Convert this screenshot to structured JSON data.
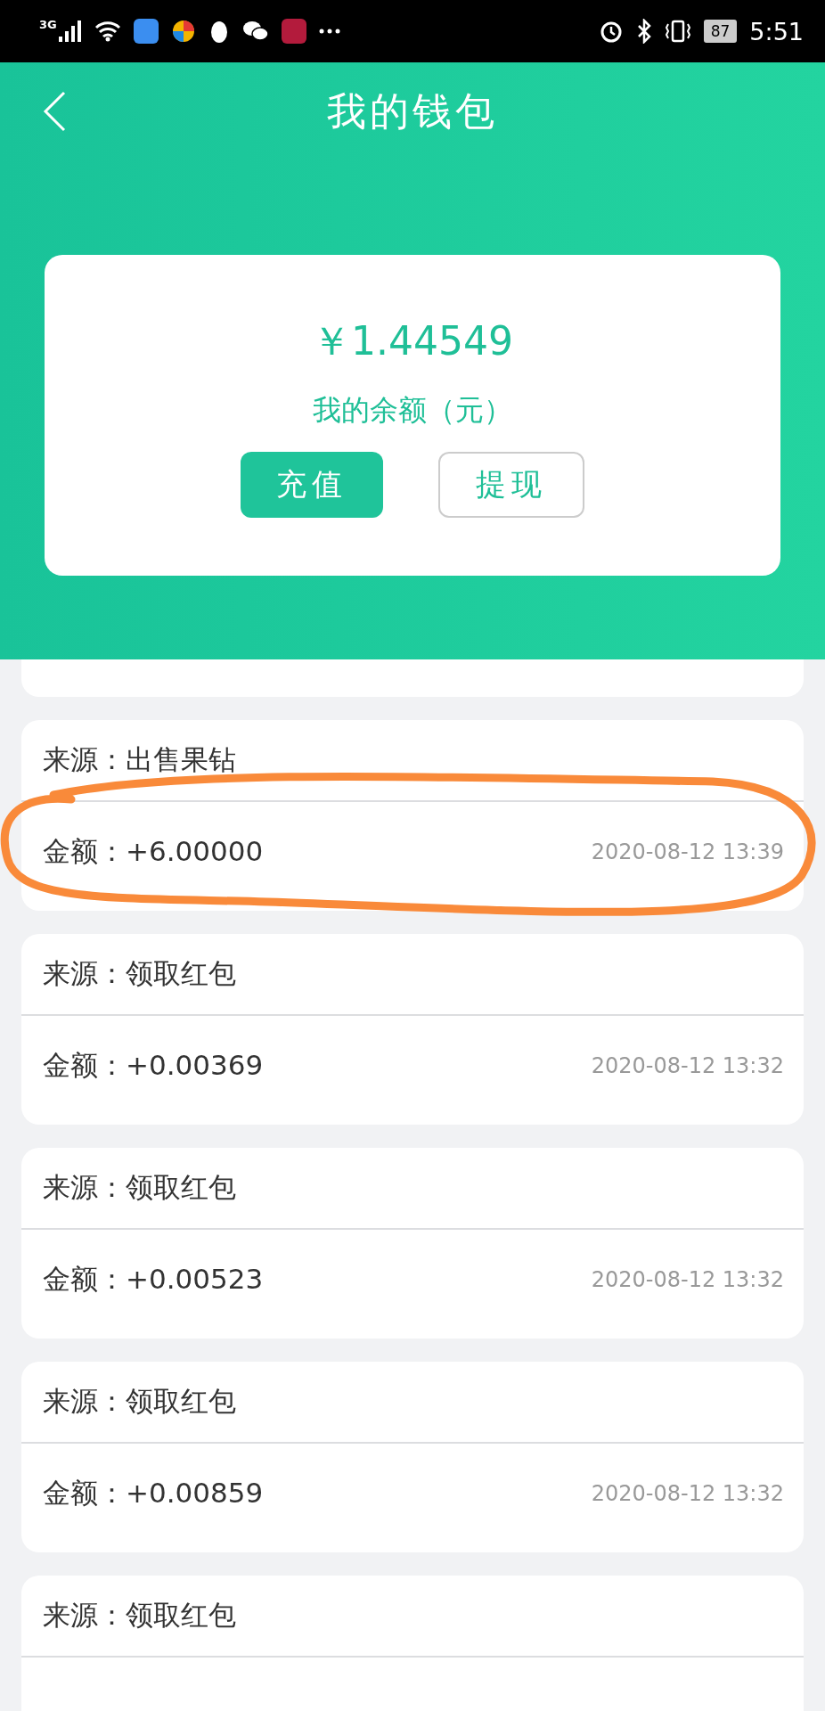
{
  "status_bar": {
    "network": "3G",
    "battery": "87",
    "time": "5:51"
  },
  "header": {
    "title": "我的钱包"
  },
  "balance_card": {
    "amount": "￥1.44549",
    "label": "我的余额（元）",
    "buttons": [
      {
        "label": "充值",
        "kind": "primary"
      },
      {
        "label": "提现",
        "kind": "outline"
      }
    ]
  },
  "records": [
    {
      "source_label": "来源：",
      "source": "出售果钻",
      "amount_label": "金额：",
      "amount": "+6.00000",
      "time": "2020-08-12 13:39",
      "highlighted": true
    },
    {
      "source_label": "来源：",
      "source": "领取红包",
      "amount_label": "金额：",
      "amount": "+0.00369",
      "time": "2020-08-12 13:32",
      "highlighted": false
    },
    {
      "source_label": "来源：",
      "source": "领取红包",
      "amount_label": "金额：",
      "amount": "+0.00523",
      "time": "2020-08-12 13:32",
      "highlighted": false
    },
    {
      "source_label": "来源：",
      "source": "领取红包",
      "amount_label": "金额：",
      "amount": "+0.00859",
      "time": "2020-08-12 13:32",
      "highlighted": false
    },
    {
      "source_label": "来源：",
      "source": "领取红包",
      "highlighted": false
    }
  ]
}
